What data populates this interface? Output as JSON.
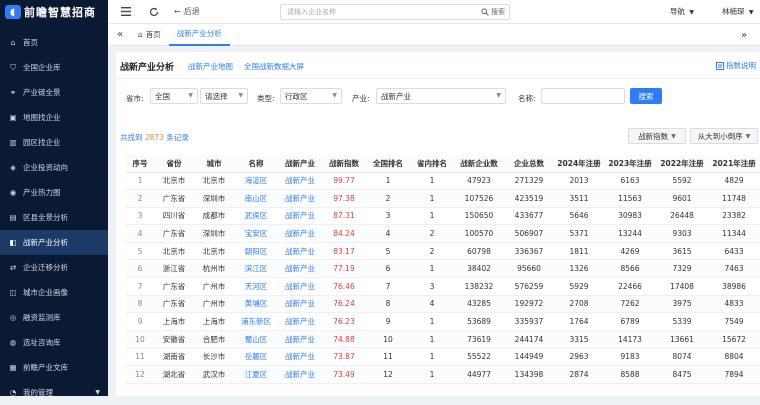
{
  "app": {
    "logo_text": "前瞻智慧招商"
  },
  "sidebar": {
    "items": [
      {
        "label": "首页",
        "icon": "home-icon",
        "active": false
      },
      {
        "label": "全国企业库",
        "icon": "shield-icon",
        "active": false
      },
      {
        "label": "产业链全景",
        "icon": "chain-icon",
        "active": false
      },
      {
        "label": "地图找企业",
        "icon": "map-icon",
        "active": false
      },
      {
        "label": "园区找企业",
        "icon": "building-icon",
        "active": false
      },
      {
        "label": "企业投资动向",
        "icon": "trend-icon",
        "active": false
      },
      {
        "label": "产业热力图",
        "icon": "heatmap-icon",
        "active": false
      },
      {
        "label": "区县全景分析",
        "icon": "chart-icon",
        "active": false
      },
      {
        "label": "战新产业分析",
        "icon": "analysis-icon",
        "active": true
      },
      {
        "label": "企业迁移分析",
        "icon": "migrate-icon",
        "active": false
      },
      {
        "label": "城市企业画像",
        "icon": "city-icon",
        "active": false
      },
      {
        "label": "融资监测库",
        "icon": "monitor-icon",
        "active": false
      },
      {
        "label": "选址咨询库",
        "icon": "pin-icon",
        "active": false
      },
      {
        "label": "前瞻产业文库",
        "icon": "book-icon",
        "active": false
      },
      {
        "label": "我的管理",
        "icon": "user-icon",
        "active": false
      }
    ]
  },
  "topbar": {
    "back_label": "后退",
    "search_placeholder": "请输入企业名称",
    "search_button": "搜索",
    "nav_menu": "导航",
    "user_name": "林楠琛"
  },
  "tabs": [
    {
      "label": "首页",
      "active": false
    },
    {
      "label": "战新产业分析",
      "active": true
    }
  ],
  "panel": {
    "title": "战新产业分析",
    "link_map": "战新产业地图",
    "link_screen": "全国战新数据大屏",
    "index_help": "指数说明"
  },
  "filters": {
    "province_label": "省市:",
    "province_value": "全国",
    "city_value": "请选择",
    "type_label": "类型:",
    "type_value": "行政区",
    "industry_label": "产业:",
    "industry_value": "战新产业",
    "name_label": "名称:",
    "name_value": "",
    "search_button": "搜索"
  },
  "results": {
    "prefix": "共找到",
    "count": "2873",
    "suffix": "条记录",
    "sort_field": "战新指数",
    "sort_order": "从大到小倒序"
  },
  "table": {
    "columns": [
      "序号",
      "省份",
      "城市",
      "名称",
      "战新产业",
      "战新指数",
      "全国排名",
      "省内排名",
      "战新企业数",
      "企业总数",
      "2024年注册",
      "2023年注册",
      "2022年注册",
      "2021年注册"
    ],
    "rows": [
      [
        "1",
        "北京市",
        "北京市",
        "海淀区",
        "战新产业",
        "99.77",
        "1",
        "1",
        "47923",
        "271329",
        "2013",
        "6163",
        "5592",
        "4829"
      ],
      [
        "2",
        "广东省",
        "深圳市",
        "南山区",
        "战新产业",
        "97.38",
        "2",
        "1",
        "107526",
        "423519",
        "3511",
        "11563",
        "9601",
        "11748"
      ],
      [
        "3",
        "四川省",
        "成都市",
        "武侯区",
        "战新产业",
        "87.31",
        "3",
        "1",
        "150650",
        "433677",
        "5646",
        "30983",
        "26448",
        "23382"
      ],
      [
        "4",
        "广东省",
        "深圳市",
        "宝安区",
        "战新产业",
        "84.24",
        "4",
        "2",
        "100570",
        "506907",
        "5371",
        "13244",
        "9303",
        "11344"
      ],
      [
        "5",
        "北京市",
        "北京市",
        "朝阳区",
        "战新产业",
        "83.17",
        "5",
        "2",
        "60798",
        "336367",
        "1811",
        "4269",
        "3615",
        "6433"
      ],
      [
        "6",
        "浙江省",
        "杭州市",
        "滨江区",
        "战新产业",
        "77.19",
        "6",
        "1",
        "38402",
        "95660",
        "1326",
        "8566",
        "7329",
        "7463"
      ],
      [
        "7",
        "广东省",
        "广州市",
        "天河区",
        "战新产业",
        "76.46",
        "7",
        "3",
        "138232",
        "576259",
        "5929",
        "22466",
        "17408",
        "38986"
      ],
      [
        "8",
        "广东省",
        "广州市",
        "黄埔区",
        "战新产业",
        "76.24",
        "8",
        "4",
        "43285",
        "192972",
        "2708",
        "7262",
        "3975",
        "4833"
      ],
      [
        "9",
        "上海市",
        "上海市",
        "浦东新区",
        "战新产业",
        "76.23",
        "9",
        "1",
        "53689",
        "335937",
        "1764",
        "6789",
        "5339",
        "7549"
      ],
      [
        "10",
        "安徽省",
        "合肥市",
        "蜀山区",
        "战新产业",
        "74.88",
        "10",
        "1",
        "73619",
        "244174",
        "3315",
        "14173",
        "13661",
        "15672"
      ],
      [
        "11",
        "湖南省",
        "长沙市",
        "岳麓区",
        "战新产业",
        "73.87",
        "11",
        "1",
        "55522",
        "144949",
        "2963",
        "9183",
        "8074",
        "8804"
      ],
      [
        "12",
        "湖北省",
        "武汉市",
        "江夏区",
        "战新产业",
        "73.49",
        "12",
        "1",
        "44977",
        "134398",
        "2874",
        "8588",
        "8475",
        "7894"
      ]
    ]
  }
}
